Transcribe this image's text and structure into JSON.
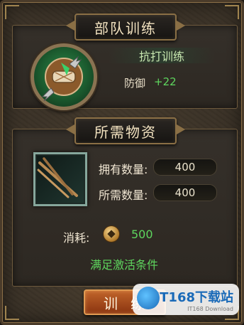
{
  "header": {
    "title": "部队训练"
  },
  "skill": {
    "name": "抗打训练",
    "stat_label": "防御",
    "stat_value": "+22"
  },
  "materials": {
    "title": "所需物资",
    "owned_label": "拥有数量:",
    "owned_value": "400",
    "required_label": "所需数量:",
    "required_value": "400",
    "item_icon": "wooden-staves-icon"
  },
  "cost": {
    "label": "消耗:",
    "value": "500",
    "currency_icon": "copper-coin-icon"
  },
  "condition_text": "满足激活条件",
  "train_button_label": "训练",
  "watermark": {
    "main": "IT168下载站",
    "sub": "IT168 Download"
  },
  "colors": {
    "accent_green": "#5ed65e",
    "button_orange": "#b4521e",
    "frame_gold": "#8a6f45"
  }
}
